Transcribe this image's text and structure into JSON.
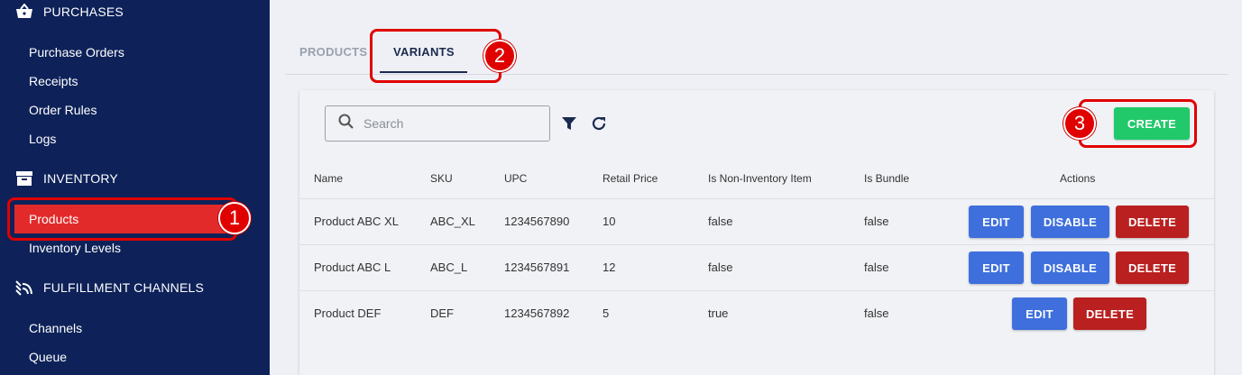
{
  "sidebar": {
    "sections": [
      {
        "title": "PURCHASES",
        "icon": "basket-icon"
      },
      {
        "title": "INVENTORY",
        "icon": "archive-box-icon"
      },
      {
        "title": "FULFILLMENT CHANNELS",
        "icon": "channels-icon"
      }
    ],
    "purchases_items": [
      "Purchase Orders",
      "Receipts",
      "Order Rules",
      "Logs"
    ],
    "inventory_items": [
      "Products",
      "Inventory Levels"
    ],
    "fulfillment_items": [
      "Channels",
      "Queue"
    ],
    "active_item": "Products"
  },
  "tabs": [
    {
      "label": "PRODUCTS",
      "active": false
    },
    {
      "label": "VARIANTS",
      "active": true
    }
  ],
  "toolbar": {
    "search_placeholder": "Search",
    "create_label": "CREATE"
  },
  "table": {
    "headers": [
      "Name",
      "SKU",
      "UPC",
      "Retail Price",
      "Is Non-Inventory Item",
      "Is Bundle",
      "Actions"
    ],
    "rows": [
      {
        "name": "Product ABC XL",
        "sku": "ABC_XL",
        "upc": "1234567890",
        "price": "10",
        "non_inventory": "false",
        "bundle": "false",
        "actions": [
          "EDIT",
          "DISABLE",
          "DELETE"
        ]
      },
      {
        "name": "Product ABC L",
        "sku": "ABC_L",
        "upc": "1234567891",
        "price": "12",
        "non_inventory": "false",
        "bundle": "false",
        "actions": [
          "EDIT",
          "DISABLE",
          "DELETE"
        ]
      },
      {
        "name": "Product DEF",
        "sku": "DEF",
        "upc": "1234567892",
        "price": "5",
        "non_inventory": "true",
        "bundle": "false",
        "actions": [
          "EDIT",
          "DELETE"
        ]
      }
    ]
  },
  "callouts": [
    "1",
    "2",
    "3"
  ],
  "colors": {
    "sidebar_bg": "#0e2259",
    "active_item": "#e22a2a",
    "create": "#22c96a",
    "edit": "#3e6fdc",
    "delete": "#b9201f",
    "callout": "#e00000"
  }
}
